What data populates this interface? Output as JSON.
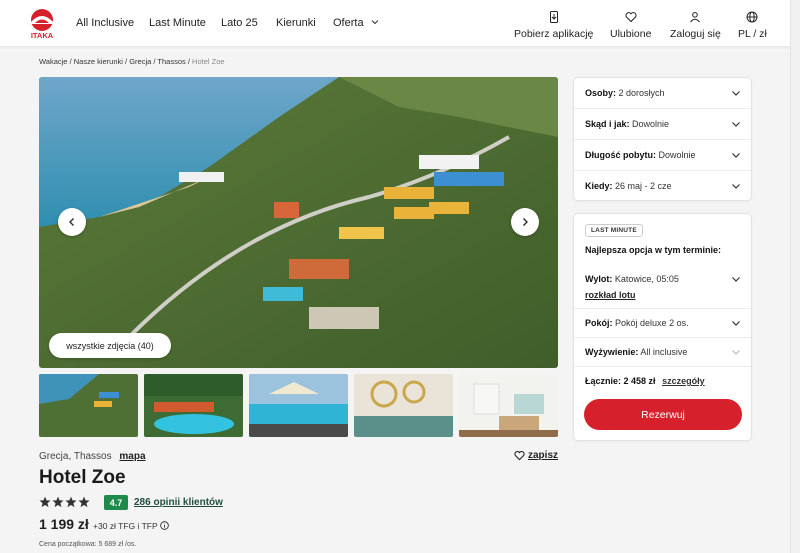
{
  "brand": {
    "logo_text": "ITAKA",
    "accent": "#d6202b"
  },
  "nav": {
    "all_inclusive": "All Inclusive",
    "last_minute": "Last Minute",
    "lato": "Lato 25",
    "kierunki": "Kierunki",
    "oferta": "Oferta"
  },
  "header_actions": {
    "app": "Pobierz aplikację",
    "favorites": "Ulubione",
    "login": "Zaloguj się",
    "lang": "PL / zł"
  },
  "breadcrumb": {
    "items": [
      "Wakacje",
      "Nasze kierunki",
      "Grecja",
      "Thassos"
    ],
    "current": "Hotel Zoe"
  },
  "gallery": {
    "all_photos": "wszystkie zdjęcia (40)"
  },
  "hotel": {
    "location": "Grecja, Thassos",
    "map_link": "mapa",
    "save": "zapisz",
    "name": "Hotel Zoe",
    "stars": 4,
    "rating": "4.7",
    "reviews": "286 opinii klientów",
    "price": "1 199 zł",
    "price_extra": "+30 zł TFG i TFP",
    "price_start": "Cena początkowa: 5 689 zł /os."
  },
  "search_panel": {
    "osoby_label": "Osoby:",
    "osoby_value": "2 dorosłych",
    "skad_label": "Skąd i jak:",
    "skad_value": "Dowolnie",
    "dlugosc_label": "Długość pobytu:",
    "dlugosc_value": "Dowolnie",
    "kiedy_label": "Kiedy:",
    "kiedy_value": "26 maj - 2 cze"
  },
  "offer_panel": {
    "badge": "LAST MINUTE",
    "headline": "Najlepsza opcja w tym terminie:",
    "wylot_label": "Wylot:",
    "wylot_value": "Katowice, 05:05",
    "flight_link": "rozkład lotu",
    "pokoj_label": "Pokój:",
    "pokoj_value": "Pokój deluxe 2 os.",
    "wyzywienie_label": "Wyżywienie:",
    "wyzywienie_value": "All inclusive",
    "total_label": "Łącznie: 2 458 zł",
    "details_link": "szczegóły",
    "book_button": "Rezerwuj"
  }
}
